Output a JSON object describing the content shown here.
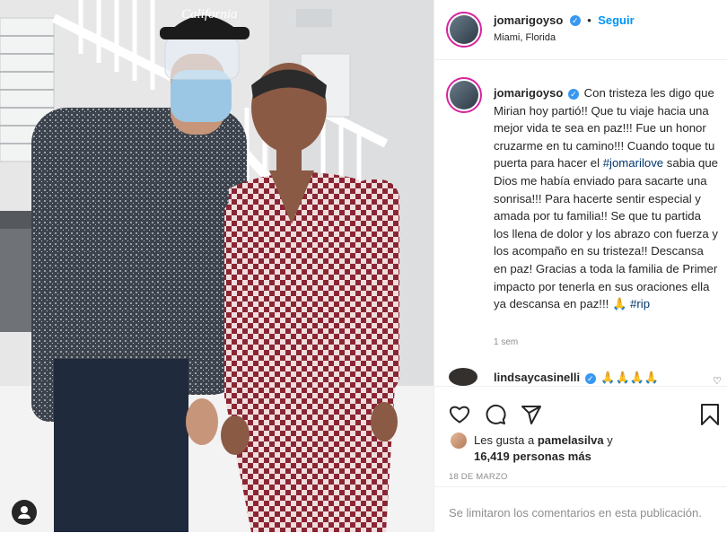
{
  "post": {
    "author": "jomarigoyso",
    "follow_label": "Seguir",
    "location": "Miami, Florida",
    "caption_text": "Con tristeza les digo que Mirian hoy partió!! Que tu viaje hacia una mejor vida te sea en paz!!! Fue un honor cruzarme en tu camino!!! Cuando toque tu puerta para hacer el ",
    "caption_hashtag_1": "#jomarilove",
    "caption_text_2": " sabia que Dios me había enviado para sacarte una sonrisa!!! Para hacerte sentir especial y amada por tu familia!! Se que tu partida los llena de dolor y los abrazo con fuerza y los acompaño en su tristeza!! Descansa en paz! Gracias a toda la familia de Primer impacto por tenerla en sus oraciones ella ya descansa en paz!!! 🙏 ",
    "caption_hashtag_2": "#rip",
    "posted_ago": "1 sem",
    "comment": {
      "user": "lindsaycasinelli",
      "text": "🙏🙏🙏🙏"
    },
    "likes": {
      "prefix": "Les gusta a",
      "liker": "pamelasilva",
      "connector": "y",
      "count_text": "16,419 personas más"
    },
    "date": "18 DE MARZO",
    "comments_limited": "Se limitaron los comentarios en esta publicación."
  },
  "photo": {
    "cap_text": "California"
  },
  "icons": {
    "verified": "verified-badge",
    "like": "heart-icon",
    "comment": "comment-icon",
    "share": "share-icon",
    "save": "bookmark-icon",
    "user_tag": "user-tag-icon"
  },
  "colors": {
    "accent": "#0095f6",
    "verified": "#3897f0",
    "hashtag": "#00376b",
    "muted": "#8e8e8e"
  }
}
